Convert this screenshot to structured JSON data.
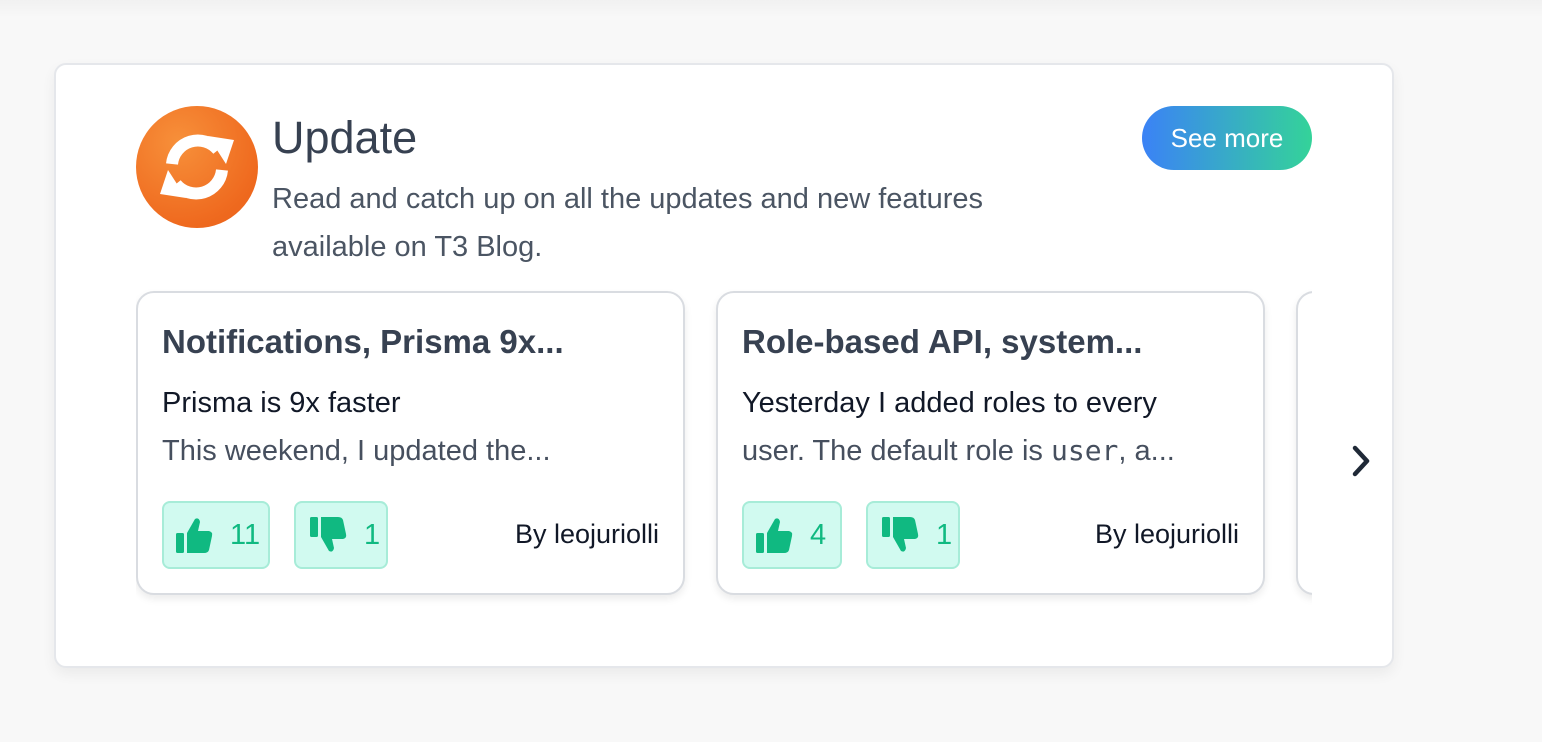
{
  "section": {
    "title": "Update",
    "description": "Read and catch up on all the updates and new features available on T3 Blog.",
    "see_more_label": "See more",
    "icon": "refresh-icon",
    "icon_color": "#ef6a1f"
  },
  "posts": [
    {
      "title": "Notifications, Prisma 9x...",
      "line1": "Prisma is 9x faster",
      "line2": "This weekend, I updated the...",
      "likes": "11",
      "dislikes": "1",
      "author": "By leojuriolli"
    },
    {
      "title": "Role-based API, system...",
      "line1": "Yesterday I added roles to every",
      "line2_before": "user. The default role is ",
      "line2_code": "user",
      "line2_after": ", a...",
      "likes": "4",
      "dislikes": "1",
      "author": "By leojuriolli"
    }
  ],
  "colors": {
    "vote_bg": "#d1faf0",
    "vote_text": "#10b981",
    "button_gradient_start": "#3b82f6",
    "button_gradient_end": "#34d399"
  },
  "next_icon": "chevron-right-icon"
}
